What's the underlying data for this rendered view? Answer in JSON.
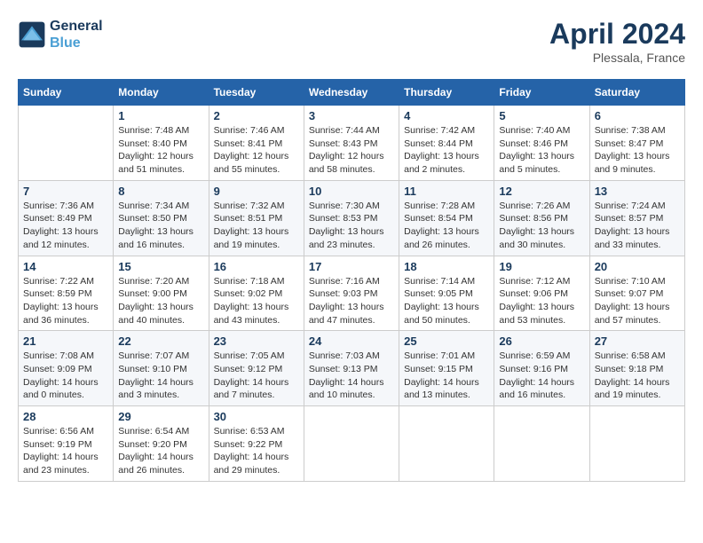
{
  "header": {
    "logo_line1": "General",
    "logo_line2": "Blue",
    "month_year": "April 2024",
    "location": "Plessala, France"
  },
  "days_of_week": [
    "Sunday",
    "Monday",
    "Tuesday",
    "Wednesday",
    "Thursday",
    "Friday",
    "Saturday"
  ],
  "weeks": [
    [
      {
        "day": "",
        "info": ""
      },
      {
        "day": "1",
        "info": "Sunrise: 7:48 AM\nSunset: 8:40 PM\nDaylight: 12 hours\nand 51 minutes."
      },
      {
        "day": "2",
        "info": "Sunrise: 7:46 AM\nSunset: 8:41 PM\nDaylight: 12 hours\nand 55 minutes."
      },
      {
        "day": "3",
        "info": "Sunrise: 7:44 AM\nSunset: 8:43 PM\nDaylight: 12 hours\nand 58 minutes."
      },
      {
        "day": "4",
        "info": "Sunrise: 7:42 AM\nSunset: 8:44 PM\nDaylight: 13 hours\nand 2 minutes."
      },
      {
        "day": "5",
        "info": "Sunrise: 7:40 AM\nSunset: 8:46 PM\nDaylight: 13 hours\nand 5 minutes."
      },
      {
        "day": "6",
        "info": "Sunrise: 7:38 AM\nSunset: 8:47 PM\nDaylight: 13 hours\nand 9 minutes."
      }
    ],
    [
      {
        "day": "7",
        "info": "Sunrise: 7:36 AM\nSunset: 8:49 PM\nDaylight: 13 hours\nand 12 minutes."
      },
      {
        "day": "8",
        "info": "Sunrise: 7:34 AM\nSunset: 8:50 PM\nDaylight: 13 hours\nand 16 minutes."
      },
      {
        "day": "9",
        "info": "Sunrise: 7:32 AM\nSunset: 8:51 PM\nDaylight: 13 hours\nand 19 minutes."
      },
      {
        "day": "10",
        "info": "Sunrise: 7:30 AM\nSunset: 8:53 PM\nDaylight: 13 hours\nand 23 minutes."
      },
      {
        "day": "11",
        "info": "Sunrise: 7:28 AM\nSunset: 8:54 PM\nDaylight: 13 hours\nand 26 minutes."
      },
      {
        "day": "12",
        "info": "Sunrise: 7:26 AM\nSunset: 8:56 PM\nDaylight: 13 hours\nand 30 minutes."
      },
      {
        "day": "13",
        "info": "Sunrise: 7:24 AM\nSunset: 8:57 PM\nDaylight: 13 hours\nand 33 minutes."
      }
    ],
    [
      {
        "day": "14",
        "info": "Sunrise: 7:22 AM\nSunset: 8:59 PM\nDaylight: 13 hours\nand 36 minutes."
      },
      {
        "day": "15",
        "info": "Sunrise: 7:20 AM\nSunset: 9:00 PM\nDaylight: 13 hours\nand 40 minutes."
      },
      {
        "day": "16",
        "info": "Sunrise: 7:18 AM\nSunset: 9:02 PM\nDaylight: 13 hours\nand 43 minutes."
      },
      {
        "day": "17",
        "info": "Sunrise: 7:16 AM\nSunset: 9:03 PM\nDaylight: 13 hours\nand 47 minutes."
      },
      {
        "day": "18",
        "info": "Sunrise: 7:14 AM\nSunset: 9:05 PM\nDaylight: 13 hours\nand 50 minutes."
      },
      {
        "day": "19",
        "info": "Sunrise: 7:12 AM\nSunset: 9:06 PM\nDaylight: 13 hours\nand 53 minutes."
      },
      {
        "day": "20",
        "info": "Sunrise: 7:10 AM\nSunset: 9:07 PM\nDaylight: 13 hours\nand 57 minutes."
      }
    ],
    [
      {
        "day": "21",
        "info": "Sunrise: 7:08 AM\nSunset: 9:09 PM\nDaylight: 14 hours\nand 0 minutes."
      },
      {
        "day": "22",
        "info": "Sunrise: 7:07 AM\nSunset: 9:10 PM\nDaylight: 14 hours\nand 3 minutes."
      },
      {
        "day": "23",
        "info": "Sunrise: 7:05 AM\nSunset: 9:12 PM\nDaylight: 14 hours\nand 7 minutes."
      },
      {
        "day": "24",
        "info": "Sunrise: 7:03 AM\nSunset: 9:13 PM\nDaylight: 14 hours\nand 10 minutes."
      },
      {
        "day": "25",
        "info": "Sunrise: 7:01 AM\nSunset: 9:15 PM\nDaylight: 14 hours\nand 13 minutes."
      },
      {
        "day": "26",
        "info": "Sunrise: 6:59 AM\nSunset: 9:16 PM\nDaylight: 14 hours\nand 16 minutes."
      },
      {
        "day": "27",
        "info": "Sunrise: 6:58 AM\nSunset: 9:18 PM\nDaylight: 14 hours\nand 19 minutes."
      }
    ],
    [
      {
        "day": "28",
        "info": "Sunrise: 6:56 AM\nSunset: 9:19 PM\nDaylight: 14 hours\nand 23 minutes."
      },
      {
        "day": "29",
        "info": "Sunrise: 6:54 AM\nSunset: 9:20 PM\nDaylight: 14 hours\nand 26 minutes."
      },
      {
        "day": "30",
        "info": "Sunrise: 6:53 AM\nSunset: 9:22 PM\nDaylight: 14 hours\nand 29 minutes."
      },
      {
        "day": "",
        "info": ""
      },
      {
        "day": "",
        "info": ""
      },
      {
        "day": "",
        "info": ""
      },
      {
        "day": "",
        "info": ""
      }
    ]
  ]
}
